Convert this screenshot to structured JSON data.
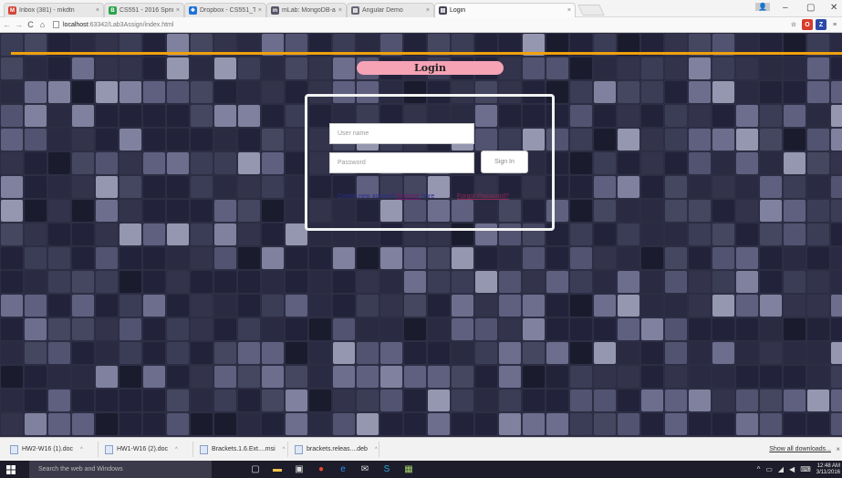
{
  "browser": {
    "tabs": [
      {
        "label": "Inbox (381) - mkdtn",
        "fav_text": "M",
        "fav_color": "#d44638"
      },
      {
        "label": "CS551 - 2016 Spring",
        "fav_text": "B",
        "fav_color": "#2aa34a"
      },
      {
        "label": "Dropbox - CS551_T",
        "fav_text": "❖",
        "fav_color": "#1f72d8"
      },
      {
        "label": "mLab: MongoDB-a",
        "fav_text": "m",
        "fav_color": "#555566"
      },
      {
        "label": "Angular Demo",
        "fav_text": "▤",
        "fav_color": "#666677"
      },
      {
        "label": "Login",
        "fav_text": "▤",
        "fav_color": "#444455"
      }
    ],
    "close_glyph": "×",
    "address": {
      "host": "localhost",
      "path": ":63342/Lab3Assign/index.html"
    },
    "window_controls": {
      "minimize": "–",
      "maximize": "▢",
      "close": "✕"
    },
    "extensions": [
      {
        "text": "☆",
        "color": "#f9f9f9",
        "fg": "#888"
      },
      {
        "text": "O",
        "color": "#d83b2b",
        "fg": "#fff"
      },
      {
        "text": "Z",
        "color": "#2b4aa8",
        "fg": "#fff"
      },
      {
        "text": "≡",
        "color": "#f9f9f9",
        "fg": "#555"
      }
    ]
  },
  "page": {
    "banner_title": "Login",
    "username_placeholder": "User name",
    "password_placeholder": "Password",
    "signin_label": "Sign In",
    "create_text_pre": "Create new account",
    "create_link": "Register",
    "create_text_post": "here",
    "forgot_link": "Forgot Password?",
    "colors": {
      "accent_line": "#f0a00e",
      "banner": "#f5a3b5",
      "box_border": "#f2f2f2"
    }
  },
  "downloads": {
    "items": [
      {
        "name": "HW2-W16 (1).doc"
      },
      {
        "name": "HW1-W16 (2).doc"
      },
      {
        "name": "Brackets.1.6.Ext....msi"
      },
      {
        "name": "brackets.releas....deb"
      }
    ],
    "caret": "^",
    "show_all": "Show all downloads...",
    "close": "×"
  },
  "taskbar": {
    "search_placeholder": "Search the web and Windows",
    "time": "12:48 AM",
    "date": "3/11/2016",
    "tray_caret": "^"
  }
}
